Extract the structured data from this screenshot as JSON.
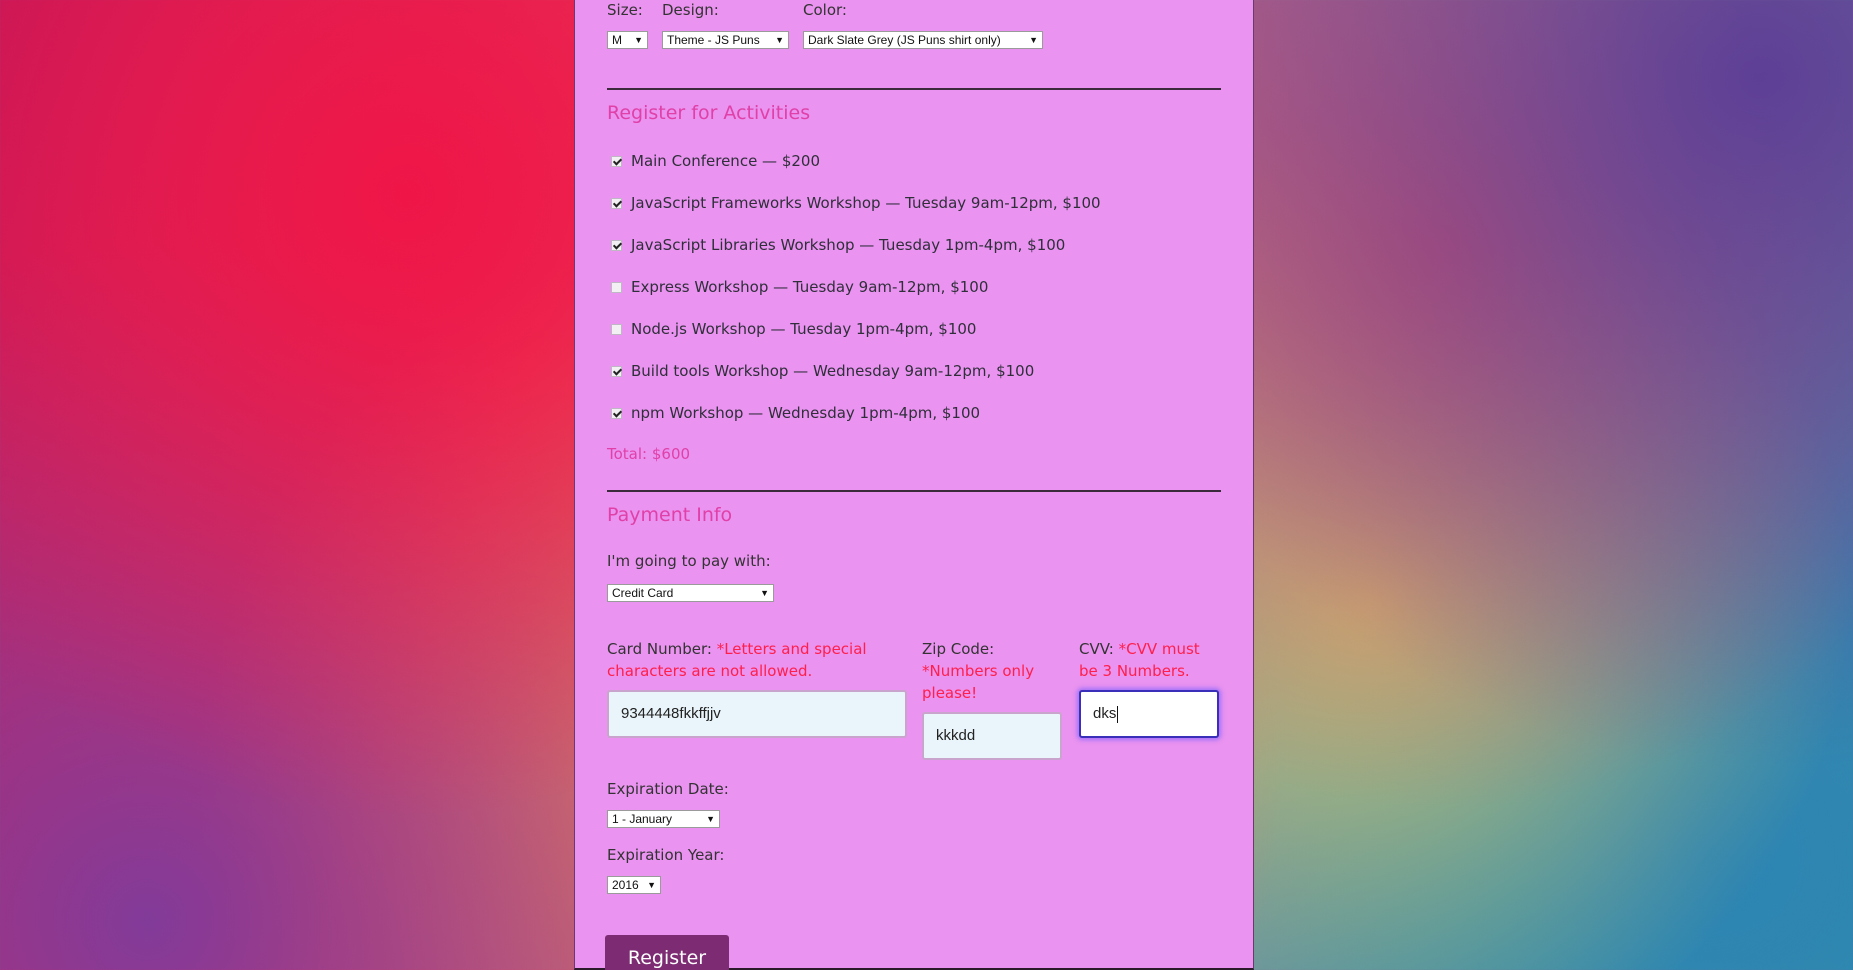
{
  "shirt": {
    "size_label": "Size:",
    "size_value": "M",
    "design_label": "Design:",
    "design_value": "Theme - JS Puns",
    "color_label": "Color:",
    "color_value": "Dark Slate Grey (JS Puns shirt only)"
  },
  "activities": {
    "title": "Register for Activities",
    "items": [
      {
        "label": "Main Conference — $200",
        "checked": true
      },
      {
        "label": "JavaScript Frameworks Workshop — Tuesday 9am-12pm, $100",
        "checked": true
      },
      {
        "label": "JavaScript Libraries Workshop — Tuesday 1pm-4pm, $100",
        "checked": true
      },
      {
        "label": "Express Workshop — Tuesday 9am-12pm, $100",
        "checked": false
      },
      {
        "label": "Node.js Workshop — Tuesday 1pm-4pm, $100",
        "checked": false
      },
      {
        "label": "Build tools Workshop — Wednesday 9am-12pm, $100",
        "checked": true
      },
      {
        "label": "npm Workshop — Wednesday 1pm-4pm, $100",
        "checked": true
      }
    ],
    "total": "Total: $600"
  },
  "payment": {
    "title": "Payment Info",
    "method_label": "I'm going to pay with:",
    "method_value": "Credit Card",
    "card_label": "Card Number:",
    "card_error": "*Letters and special characters are not allowed.",
    "card_value": "9344448fkkffjjv",
    "zip_label": "Zip Code:",
    "zip_error": "*Numbers only please!",
    "zip_value": "kkkdd",
    "cvv_label": "CVV:",
    "cvv_error": "*CVV must be 3 Numbers.",
    "cvv_value": "dks",
    "exp_date_label": "Expiration Date:",
    "exp_date_value": "1 - January",
    "exp_year_label": "Expiration Year:",
    "exp_year_value": "2016"
  },
  "register_label": "Register",
  "icons": {
    "dropdown": "chevron-down-icon",
    "checkbox": "checkbox-icon"
  },
  "colors": {
    "panel": "#ea93f0",
    "accent": "#e040a8",
    "error": "#ff1f4a",
    "button": "#7d2c74"
  }
}
